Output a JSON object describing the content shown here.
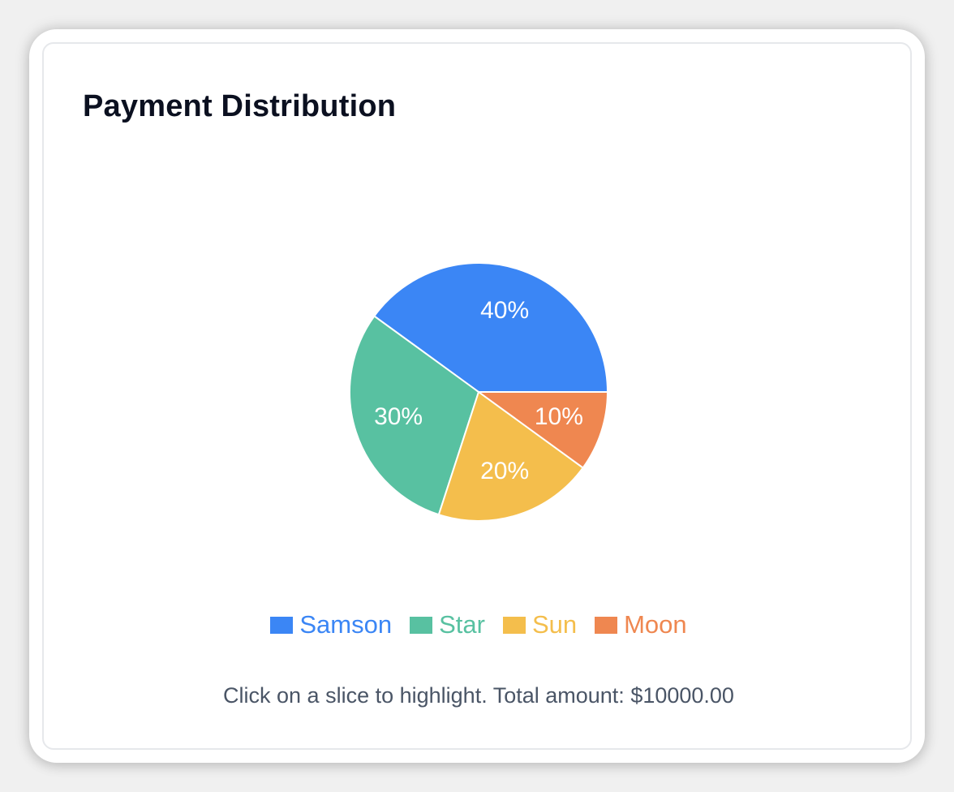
{
  "card": {
    "title": "Payment Distribution",
    "footer_prefix": "Click on a slice to highlight. Total amount: ",
    "total_amount": "$10000.00"
  },
  "chart_data": {
    "type": "pie",
    "categories": [
      "Samson",
      "Star",
      "Sun",
      "Moon"
    ],
    "values": [
      40,
      30,
      20,
      10
    ],
    "labels": [
      "40%",
      "30%",
      "20%",
      "10%"
    ],
    "colors": [
      "#3b86f5",
      "#58c1a1",
      "#f4be4c",
      "#ef8750"
    ],
    "legend_position": "bottom"
  }
}
